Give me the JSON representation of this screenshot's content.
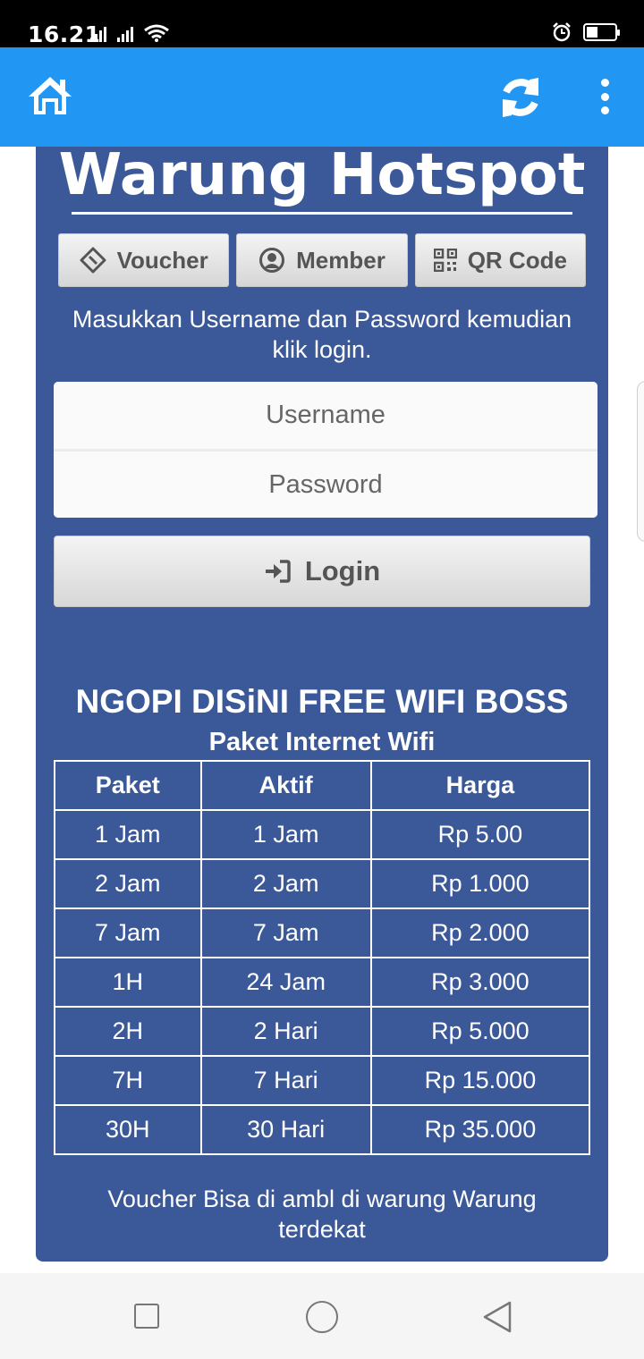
{
  "status_bar": {
    "time": "16.21",
    "icons": [
      "signal-icon",
      "signal-icon",
      "wifi-icon",
      "alarm-icon",
      "battery-icon"
    ]
  },
  "app_bar": {
    "background": "#2196f3",
    "icons": [
      "home-icon",
      "refresh-icon",
      "more-vert-icon"
    ]
  },
  "card": {
    "background": "#3b5998",
    "title": "Warung Hotspot",
    "tabs": [
      {
        "label": "Voucher",
        "icon": "ticket-icon"
      },
      {
        "label": "Member",
        "icon": "user-circle-icon"
      },
      {
        "label": "QR Code",
        "icon": "qrcode-icon"
      }
    ],
    "instructions": "Masukkan Username dan Password kemudian klik login.",
    "username_placeholder": "Username",
    "password_placeholder": "Password",
    "login_label": "Login",
    "login_icon": "sign-in-icon",
    "heading": "NGOPI DISiNI FREE WIFI BOSS",
    "subheading": "Paket Internet Wifi",
    "table": {
      "headers": [
        "Paket",
        "Aktif",
        "Harga"
      ],
      "rows": [
        [
          "1 Jam",
          "1 Jam",
          "Rp 5.00"
        ],
        [
          "2 Jam",
          "2 Jam",
          "Rp 1.000"
        ],
        [
          "7 Jam",
          "7 Jam",
          "Rp 2.000"
        ],
        [
          "1H",
          "24 Jam",
          "Rp 3.000"
        ],
        [
          "2H",
          "2 Hari",
          "Rp 5.000"
        ],
        [
          "7H",
          "7 Hari",
          "Rp 15.000"
        ],
        [
          "30H",
          "30 Hari",
          "Rp 35.000"
        ]
      ]
    },
    "footer_note": "Voucher Bisa di ambl di warung Warung terdekat"
  },
  "nav_bar": {
    "icons": [
      "recent-apps-icon",
      "home-circle-icon",
      "back-icon"
    ]
  }
}
